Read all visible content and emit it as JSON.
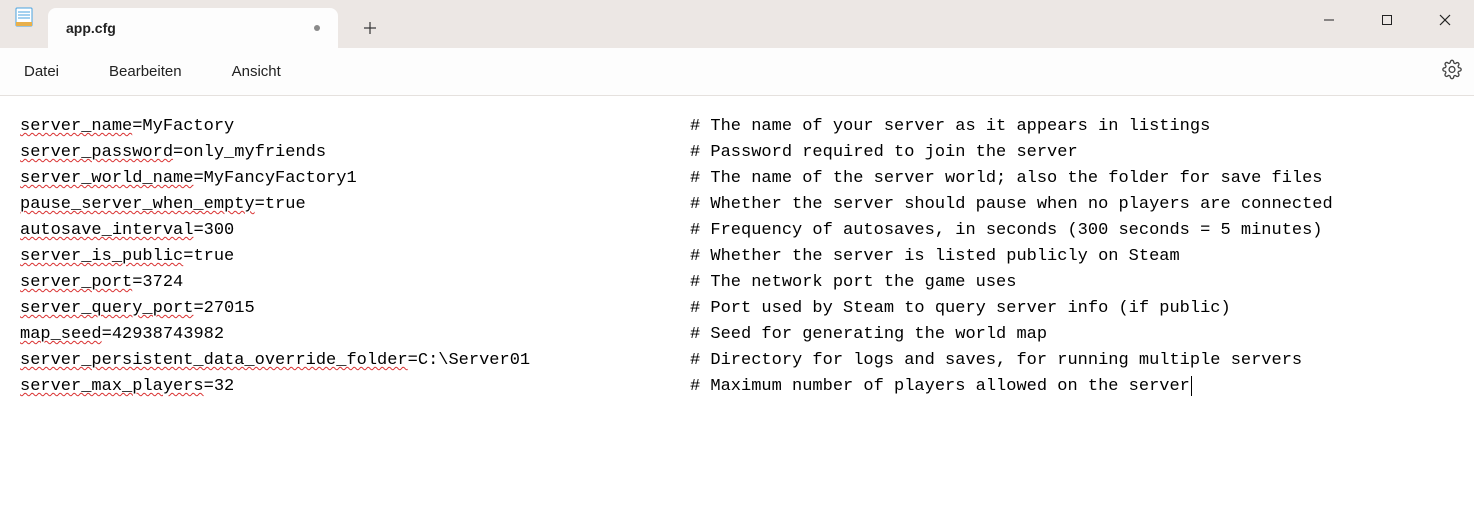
{
  "window": {
    "tab_title": "app.cfg",
    "menu": {
      "file": "Datei",
      "edit": "Bearbeiten",
      "view": "Ansicht"
    }
  },
  "config_lines": [
    {
      "key": "server_name",
      "value": "MyFactory",
      "comment": "# The name of your server as it appears in listings"
    },
    {
      "key": "server_password",
      "value": "only_myfriends",
      "comment": "# Password required to join the server"
    },
    {
      "key": "server_world_name",
      "value": "MyFancyFactory1",
      "comment": "# The name of the server world; also the folder for save files"
    },
    {
      "key": "pause_server_when_empty",
      "value": "true",
      "comment": "# Whether the server should pause when no players are connected"
    },
    {
      "key": "autosave_interval",
      "value": "300",
      "comment": "# Frequency of autosaves, in seconds (300 seconds = 5 minutes)"
    },
    {
      "key": "server_is_public",
      "value": "true",
      "comment": "# Whether the server is listed publicly on Steam"
    },
    {
      "key": "server_port",
      "value": "3724",
      "comment": "# The network port the game uses"
    },
    {
      "key": "server_query_port",
      "value": "27015",
      "comment": "# Port used by Steam to query server info (if public)"
    },
    {
      "key": "map_seed",
      "value": "42938743982",
      "comment": "# Seed for generating the world map"
    },
    {
      "key": "server_persistent_data_override_folder",
      "value": "C:\\Server01",
      "comment": "# Directory for logs and saves, for running multiple servers"
    },
    {
      "key": "server_max_players",
      "value": "32",
      "comment": "# Maximum number of players allowed on the server"
    }
  ]
}
